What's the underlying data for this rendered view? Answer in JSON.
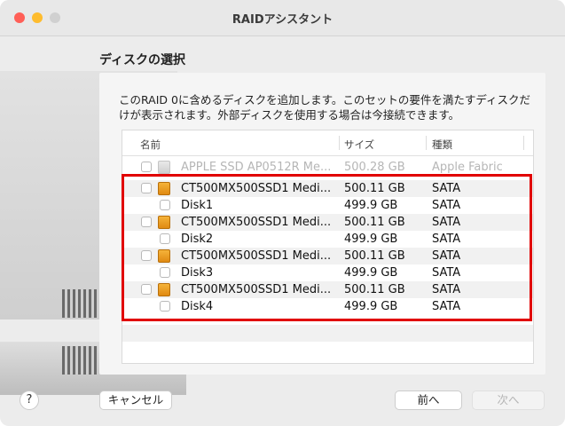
{
  "window": {
    "title": "RAIDアシスタント"
  },
  "page": {
    "heading": "ディスクの選択",
    "description": "このRAID 0に含めるディスクを追加します。このセットの要件を満たすディスクだけが表示されます。外部ディスクを使用する場合は今接続できます。"
  },
  "table": {
    "headers": {
      "name": "名前",
      "size": "サイズ",
      "type": "種類"
    },
    "rows": [
      {
        "name": "APPLE SSD AP0512R Me...",
        "size": "500.28 GB",
        "type": "Apple Fabric",
        "enabled": false,
        "icon": "gray-drive-icon"
      },
      {
        "name": "CT500MX500SSD1 Medi...",
        "size": "500.11 GB",
        "type": "SATA",
        "enabled": true,
        "icon": "orange-drive-icon"
      },
      {
        "name": "Disk1",
        "size": "499.9 GB",
        "type": "SATA",
        "enabled": true
      },
      {
        "name": "CT500MX500SSD1 Medi...",
        "size": "500.11 GB",
        "type": "SATA",
        "enabled": true,
        "icon": "orange-drive-icon"
      },
      {
        "name": "Disk2",
        "size": "499.9 GB",
        "type": "SATA",
        "enabled": true
      },
      {
        "name": "CT500MX500SSD1 Medi...",
        "size": "500.11 GB",
        "type": "SATA",
        "enabled": true,
        "icon": "orange-drive-icon"
      },
      {
        "name": "Disk3",
        "size": "499.9 GB",
        "type": "SATA",
        "enabled": true
      },
      {
        "name": "CT500MX500SSD1 Medi...",
        "size": "500.11 GB",
        "type": "SATA",
        "enabled": true,
        "icon": "orange-drive-icon"
      },
      {
        "name": "Disk4",
        "size": "499.9 GB",
        "type": "SATA",
        "enabled": true
      }
    ]
  },
  "buttons": {
    "help": "?",
    "cancel": "キャンセル",
    "back": "前へ",
    "next": "次へ"
  },
  "colors": {
    "highlight": "#e10000",
    "drive_orange": "#f0a020"
  }
}
